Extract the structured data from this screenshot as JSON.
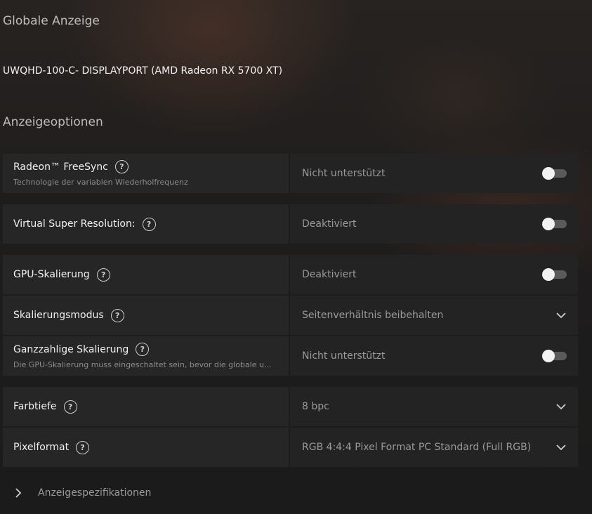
{
  "header": {
    "title": "Globale Anzeige",
    "display": "UWQHD-100-C- DISPLAYPORT (AMD Radeon RX 5700 XT)",
    "section": "Anzeigeoptionen"
  },
  "rows": {
    "freesync": {
      "label": "Radeon™ FreeSync",
      "sub": "Technologie der variablen Wiederholfrequenz",
      "value": "Nicht unterstützt",
      "control": "toggle-off"
    },
    "vsr": {
      "label": "Virtual Super Resolution:",
      "value": "Deaktiviert",
      "control": "toggle-off"
    },
    "gpu_scaling": {
      "label": "GPU-Skalierung",
      "value": "Deaktiviert",
      "control": "toggle-off"
    },
    "scaling_mode": {
      "label": "Skalierungsmodus",
      "value": "Seitenverhältnis beibehalten",
      "control": "dropdown"
    },
    "integer_scaling": {
      "label": "Ganzzahlige Skalierung",
      "sub": "Die GPU-Skalierung muss eingeschaltet sein, bevor die globale u...",
      "value": "Nicht unterstützt",
      "control": "toggle-off"
    },
    "color_depth": {
      "label": "Farbtiefe",
      "value": "8 bpc",
      "control": "dropdown"
    },
    "pixel_format": {
      "label": "Pixelformat",
      "value": "RGB 4:4:4 Pixel Format PC Standard (Full RGB)",
      "control": "dropdown"
    }
  },
  "footer": {
    "specs_label": "Anzeigespezifikationen"
  },
  "icons": {
    "help": "help-circle-icon",
    "toggle": "toggle-switch",
    "dropdown": "chevron-down-icon",
    "expand": "chevron-right-icon"
  },
  "colors": {
    "background": "#1c1c1c",
    "row_left": "#262626",
    "row_right": "#232323",
    "text_primary": "#f0f0f0",
    "text_muted": "#9a9a9a"
  }
}
